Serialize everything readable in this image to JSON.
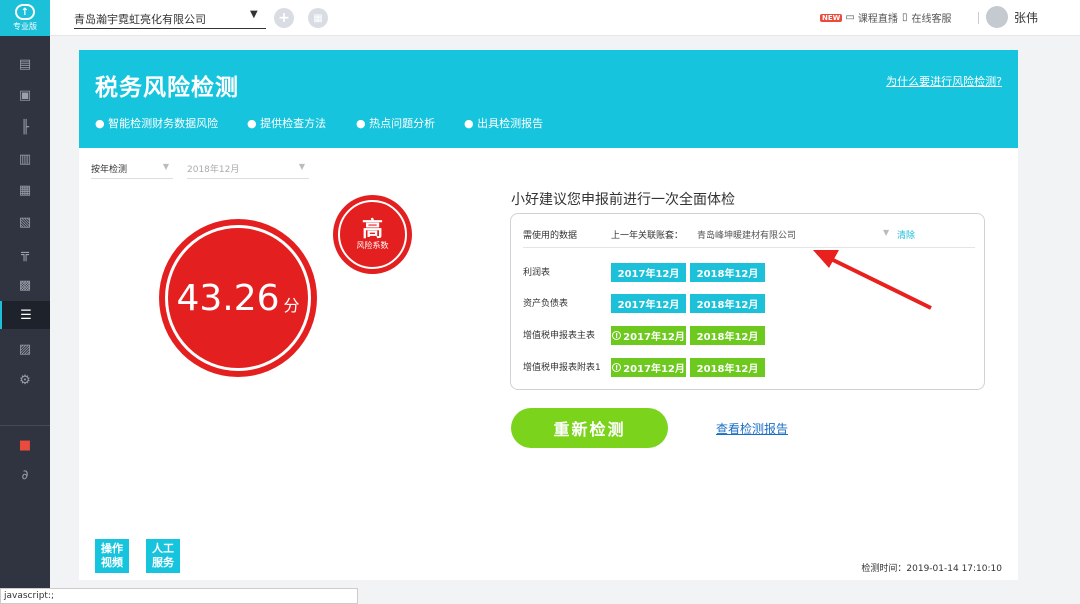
{
  "logo": {
    "edition": "专业版"
  },
  "topbar": {
    "company": "青岛瀚宇霓虹亮化有限公司",
    "live": "课程直播",
    "live_badge": "NEW",
    "service": "在线客服",
    "user": "张伟"
  },
  "banner": {
    "title": "税务风险检测",
    "link": "为什么要进行风险检测?",
    "features": [
      "● 智能检测财务数据风险",
      "● 提供检查方法",
      "● 热点问题分析",
      "● 出具检测报告"
    ]
  },
  "filters": {
    "mode": "按年检测",
    "period": "2018年12月"
  },
  "score": {
    "value": "43.26",
    "unit": "分",
    "risk_level": "高",
    "risk_label": "风险系数"
  },
  "panel": {
    "title": "小好建议您申报前进行一次全面体检",
    "head_data": "需使用的数据",
    "head_prev": "上一年关联账套：",
    "head_company": "青岛峰坤暖建材有限公司",
    "head_clear": "清除",
    "rows": [
      {
        "label": "利润表",
        "p1": "2017年12月",
        "p2": "2018年12月",
        "warn": ""
      },
      {
        "label": "资产负债表",
        "p1": "2017年12月",
        "p2": "2018年12月",
        "warn": ""
      },
      {
        "label": "增值税申报表主表",
        "p1": "2017年12月",
        "p2": "2018年12月",
        "warn": "!"
      },
      {
        "label": "增值税申报表附表1",
        "p1": "2017年12月",
        "p2": "2018年12月",
        "warn": "!"
      }
    ]
  },
  "actions": {
    "recheck": "重新检测",
    "view_report": "查看检测报告"
  },
  "help": {
    "video": "操作\n视频",
    "service": "人工\n服务"
  },
  "check_time": "检测时间：2019-01-14 17:10:10",
  "statusbar": "javascript:;",
  "colors": {
    "accent": "#17c4de",
    "risk": "#e41f1f",
    "ok": "#6dc91e"
  }
}
